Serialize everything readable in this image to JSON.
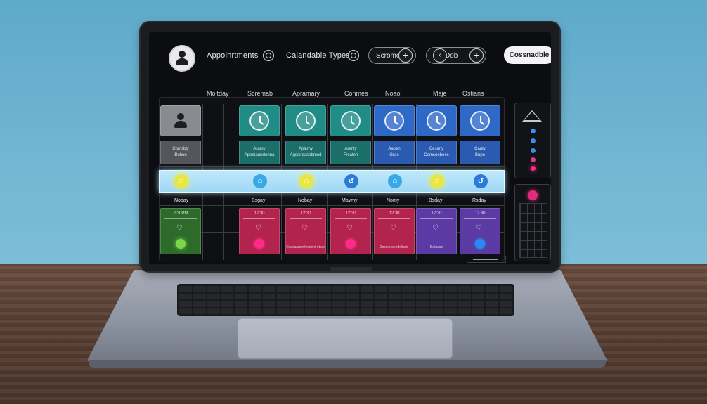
{
  "header": {
    "nav_appointments": "Appoinrtments",
    "nav_calendar_types": "Calandable Types",
    "pill_search_label": "Scromo",
    "pill_dob_label": "Dob",
    "primary_button": "Cossnadble"
  },
  "columns": [
    "Moltday",
    "Scremab",
    "Apramary",
    "Conmes",
    "Noao",
    "Maje",
    "Ostians"
  ],
  "rows": {
    "label_row_1": [
      [
        "Comsbly",
        "Buhon"
      ],
      [
        "Aramy",
        "Apomanretenna"
      ],
      [
        "Aplemy",
        "Agsaneasebmed"
      ],
      [
        "Arenty",
        "Freaten"
      ],
      [
        "Aapen",
        "Grae"
      ],
      [
        "Cesany",
        "Comsoebees"
      ],
      [
        "Canty",
        "Bupo"
      ]
    ],
    "day_labels": [
      "Nobay",
      "Bsgay",
      "Nobay",
      "Maymy",
      "Nomy",
      "Bsday",
      "Rsday"
    ],
    "event_times": [
      "2:30PM",
      "12:30",
      "12:30",
      "12:30",
      "12:30",
      "12:30",
      "12:30"
    ],
    "event_notes": [
      "",
      "",
      "Cossaaunwlesnent etsas",
      "",
      "Zossenanedeliade",
      "Batasas",
      ""
    ]
  },
  "colors": {
    "teal": "#1f8c86",
    "blue": "#2f69c8",
    "crimson": "#b2234d",
    "purple": "#5b3aa3",
    "green": "#2e6b2a",
    "highlight": "#bfe9fb"
  },
  "icons": [
    "user-icon",
    "clock-icon",
    "heart-icon",
    "smile-icon",
    "plus-icon",
    "triangle-icon"
  ]
}
